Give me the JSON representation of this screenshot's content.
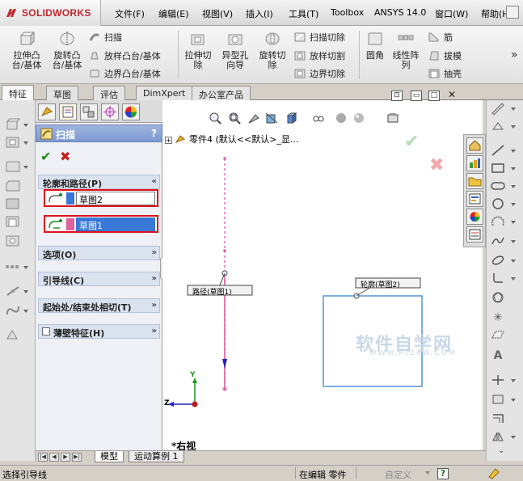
{
  "app": {
    "brand": "SOLIDWORKS"
  },
  "menu": {
    "items": [
      "文件(F)",
      "编辑(E)",
      "视图(V)",
      "插入(I)",
      "工具(T)",
      "Toolbox",
      "ANSYS 14.0",
      "窗口(W)",
      "帮助(H)"
    ]
  },
  "toolbar": {
    "extrude_boss": "拉伸凸\n台/基体",
    "revolve_boss": "旋转凸\n台/基体",
    "sweep": "扫描",
    "loft_boss": "放样凸台/基体",
    "boundary_boss": "边界凸台/基体",
    "extrude_cut": "拉伸切\n除",
    "hole_wizard": "异型孔\n向导",
    "revolve_cut": "旋转切\n除",
    "sweep_cut": "扫描切除",
    "loft_cut": "放样切割",
    "boundary_cut": "边界切除",
    "fillet": "圆角",
    "linear_pattern": "线性阵\n列",
    "rib": "筋",
    "draft": "拔模",
    "shell": "抽壳"
  },
  "tabs": [
    {
      "label": "特征",
      "active": true
    },
    {
      "label": "草图",
      "active": false
    },
    {
      "label": "评估",
      "active": false
    },
    {
      "label": "DimXpert",
      "active": false
    },
    {
      "label": "办公室产品",
      "active": false
    }
  ],
  "property_manager": {
    "title": "扫描",
    "help": "?",
    "ok": "✔",
    "cancel": "✖",
    "profile_path_group": "轮廓和路径(P)",
    "profile_field": "草图2",
    "path_field": "草图1",
    "options_group": "选项(O)",
    "guide_curves_group": "引导线(C)",
    "tangency_group": "起始处/结束处相切(T)",
    "thin_feature_group": "薄壁特征(H)",
    "colors": {
      "profile": "#3a78d8",
      "path": "#e060a0"
    }
  },
  "graphics": {
    "tree_root": "零件4 (默认<<默认>_显...",
    "path_label": "路径(草图1)",
    "profile_label": "轮廓(草图2)",
    "view_name": "*右视",
    "axis_y": "Y",
    "axis_z": "Z",
    "watermark_main": "软件自学网",
    "watermark_sub": "WWW.RJZXW.COM",
    "win_restore": "⊡",
    "win_min": "▭",
    "win_max": "□",
    "win_close": "✕"
  },
  "bottom_tabs": [
    {
      "label": "模型",
      "active": true
    },
    {
      "label": "运动算例 1",
      "active": false
    }
  ],
  "status": {
    "prompt": "选择引导线",
    "mode": "在编辑 零件",
    "custom": "自定义",
    "help_icon": "?"
  }
}
